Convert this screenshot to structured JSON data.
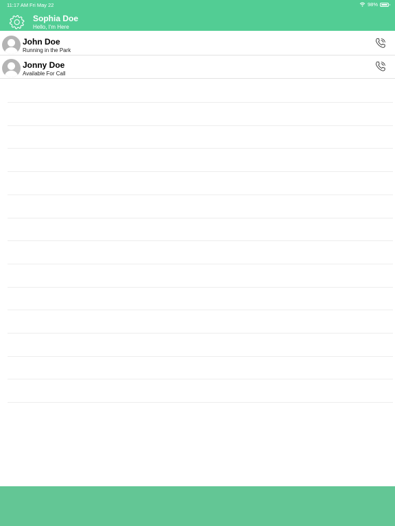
{
  "status_bar": {
    "time": "11:17 AM",
    "date": "Fri May 22",
    "battery": "98%",
    "battery_level": 0.98
  },
  "profile": {
    "name": "Sophia Doe",
    "status": "Hello, I'm Here",
    "settings_icon": "gear-icon"
  },
  "contacts": [
    {
      "name": "John Doe",
      "status": "Running in the Park",
      "action_icon": "phone-icon"
    },
    {
      "name": "Jonny Doe",
      "status": "Available For Call",
      "action_icon": "phone-icon"
    }
  ],
  "colors": {
    "header": "#52cd94",
    "bottom_bar": "#63c695",
    "avatar": "#b4b4b4"
  }
}
